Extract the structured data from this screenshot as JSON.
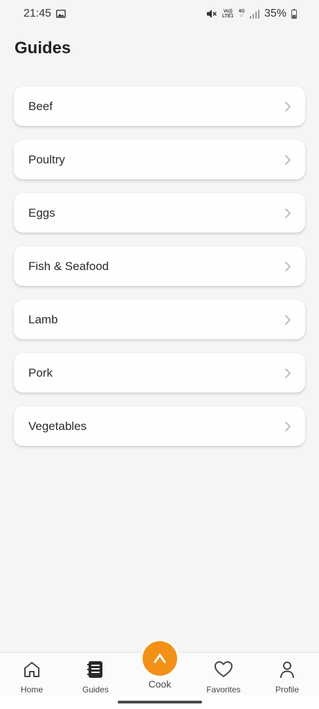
{
  "status_bar": {
    "time": "21:45",
    "network_top": "Vo))",
    "network_bottom": "LTE1",
    "network_type": "4G",
    "battery": "35%",
    "icons": [
      "gallery-icon",
      "mute-icon",
      "signal-icon",
      "battery-icon"
    ]
  },
  "page": {
    "title": "Guides"
  },
  "guides": [
    {
      "label": "Beef"
    },
    {
      "label": "Poultry"
    },
    {
      "label": "Eggs"
    },
    {
      "label": "Fish & Seafood"
    },
    {
      "label": "Lamb"
    },
    {
      "label": "Pork"
    },
    {
      "label": "Vegetables"
    }
  ],
  "bottom_nav": {
    "home": "Home",
    "guides": "Guides",
    "cook": "Cook",
    "favorites": "Favorites",
    "profile": "Profile",
    "active": "guides"
  },
  "colors": {
    "accent": "#f39018",
    "background": "#f5f5f4",
    "card": "#fefefe"
  }
}
